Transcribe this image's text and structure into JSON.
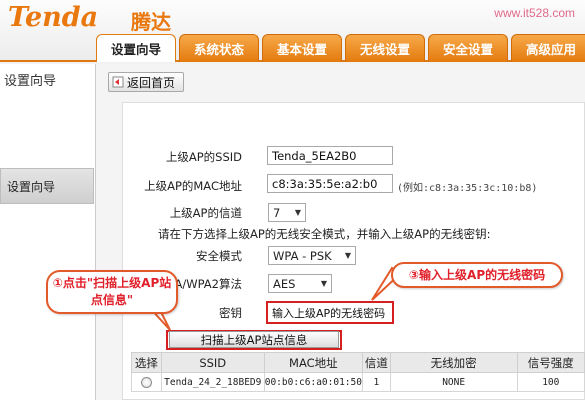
{
  "header": {
    "logo_text": "Tenda",
    "logo_cn": "腾达",
    "watermark": "www.it528.com",
    "brand_color": "#e9780f"
  },
  "tabs": [
    {
      "label": "设置向导",
      "active": true
    },
    {
      "label": "系统状态",
      "active": false
    },
    {
      "label": "基本设置",
      "active": false
    },
    {
      "label": "无线设置",
      "active": false
    },
    {
      "label": "安全设置",
      "active": false
    },
    {
      "label": "高级应用",
      "active": false
    }
  ],
  "sidebar": {
    "title": "设置向导",
    "items": [
      {
        "label": "设置向导"
      }
    ]
  },
  "main": {
    "back_button": "返回首页",
    "form": {
      "ssid_label": "上级AP的SSID",
      "ssid_value": "Tenda_5EA2B0",
      "mac_label": "上级AP的MAC地址",
      "mac_value": "c8:3a:35:5e:a2:b0",
      "mac_hint": "(例如:c8:3a:35:3c:10:b8)",
      "channel_label": "上级AP的信道",
      "channel_value": "7",
      "note": "请在下方选择上级AP的无线安全模式，并输入上级AP的无线密钥:",
      "security_label": "安全模式",
      "security_value": "WPA - PSK",
      "algorithm_label": "A/WPA2算法",
      "algorithm_value": "AES",
      "key_label": "密钥",
      "key_value": "输入上级AP的无线密码",
      "scan_button": "扫描上级AP站点信息"
    },
    "table": {
      "headers": [
        "选择",
        "SSID",
        "MAC地址",
        "信道",
        "无线加密",
        "信号强度"
      ],
      "rows": [
        [
          "",
          "Tenda_24_2_18BED9",
          "00:b0:c6:a0:01:50",
          "1",
          "NONE",
          "100"
        ]
      ]
    }
  },
  "callouts": {
    "step1": "①点击\"扫描上级AP站点信息\"",
    "step3": "③输入上级AP的无线密码",
    "color": "#e0202a"
  }
}
